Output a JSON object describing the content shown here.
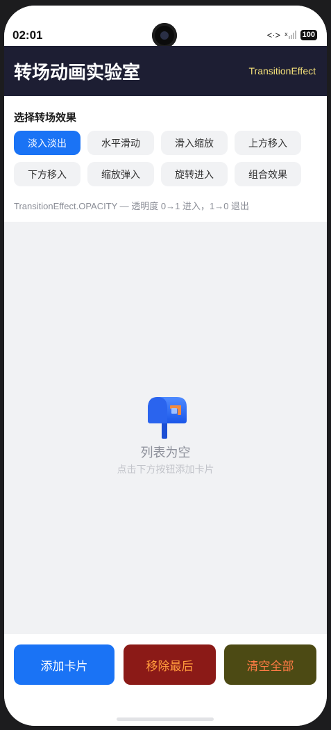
{
  "status_bar": {
    "time": "02:01",
    "network_symbol": "<·>",
    "signal_badge": "x",
    "battery": "100"
  },
  "header": {
    "title": "转场动画实验室",
    "subtitle": "TransitionEffect"
  },
  "effects": {
    "section_title": "选择转场效果",
    "options": [
      "淡入淡出",
      "水平滑动",
      "滑入缩放",
      "上方移入",
      "下方移入",
      "缩放弹入",
      "旋转进入",
      "组合效果"
    ],
    "selected": "淡入淡出",
    "description": "TransitionEffect.OPACITY — 透明度 0→1 进入，1→0 退出"
  },
  "list": {
    "empty_icon": "mailbox-icon",
    "empty_title": "列表为空",
    "empty_hint": "点击下方按钮添加卡片"
  },
  "actions": {
    "add_label": "添加卡片",
    "remove_label": "移除最后",
    "clear_label": "清空全部"
  },
  "colors": {
    "header_bg": "#1d1e33",
    "accent": "#1a73f5",
    "subtitle": "#f6e27a",
    "remove_bg": "#8b1a17",
    "clear_bg": "#4c4a14"
  }
}
